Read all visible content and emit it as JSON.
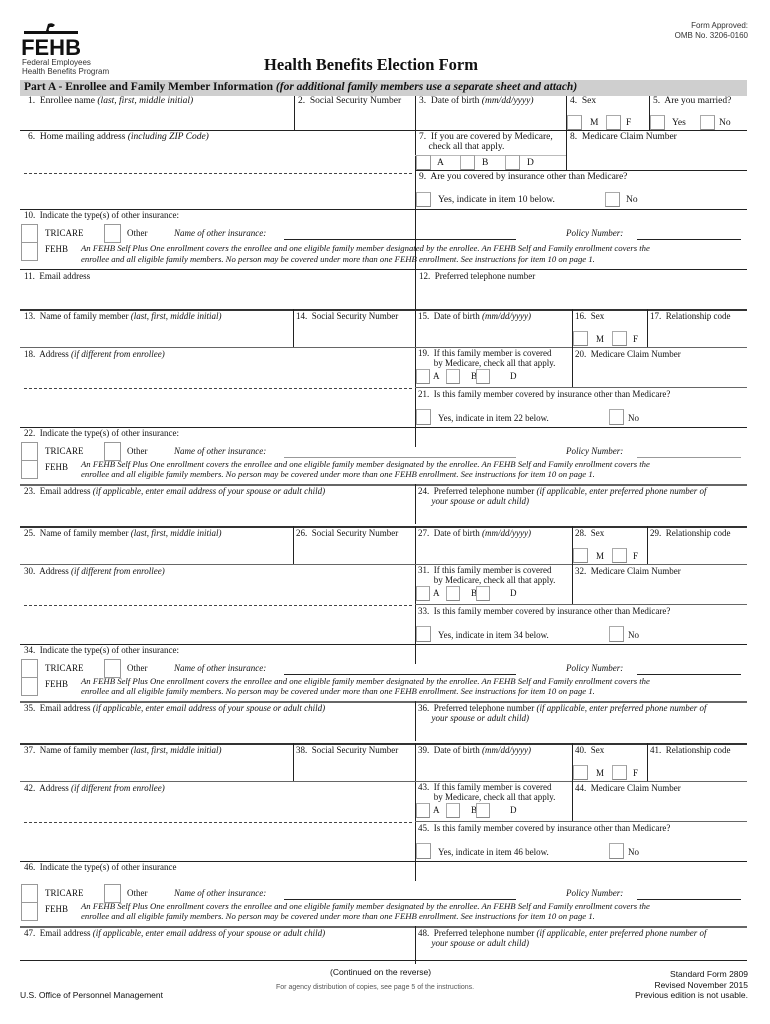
{
  "header": {
    "logo_text": "FEHB",
    "org_line1": "Federal Employees",
    "org_line2": "Health Benefits Program",
    "title": "Health Benefits Election Form",
    "approval_line1": "Form Approved:",
    "approval_line2": "OMB No. 3206-0160",
    "icon": "eagle-icon"
  },
  "part_a": {
    "title": "Part A - Enrollee and Family Member Information",
    "subtitle": "(for additional family members use a separate sheet and attach)"
  },
  "enrollee": {
    "f1_num": "1.",
    "f1_label": "Enrollee name",
    "f1_hint": "(last, first, middle initial)",
    "f2_num": "2.",
    "f2_label": "Social Security Number",
    "f3_num": "3.",
    "f3_label": "Date of birth",
    "f3_hint": "(mm/dd/yyyy)",
    "f4_num": "4.",
    "f4_label": "Sex",
    "sex_m": "M",
    "sex_f": "F",
    "f5_num": "5.",
    "f5_label": "Are you married?",
    "yes": "Yes",
    "no": "No",
    "f6_num": "6.",
    "f6_label": "Home mailing address",
    "f6_hint": "(including ZIP Code)",
    "f7_num": "7.",
    "f7_label_l1": "If you are covered by Medicare,",
    "f7_label_l2": "check all that apply.",
    "med_a": "A",
    "med_b": "B",
    "med_d": "D",
    "f8_num": "8.",
    "f8_label": "Medicare Claim Number",
    "f9_num": "9.",
    "f9_label": "Are you covered by insurance other than Medicare?",
    "f9_yes": "Yes, indicate in item 10 below.",
    "f9_no": "No",
    "f10_num": "10.",
    "f10_label": "Indicate the type(s) of other insurance:",
    "f11_num": "11.",
    "f11_label": "Email address",
    "f12_num": "12.",
    "f12_label": "Preferred telephone number"
  },
  "insurance_block": {
    "tricare": "TRICARE",
    "other": "Other",
    "name_label": "Name of other insurance:",
    "policy_label": "Policy Number:",
    "fehb": "FEHB",
    "fehb_note_l1": "An FEHB Self Plus One enrollment covers the enrollee and one eligible family member designated by the enrollee. An FEHB Self and Family enrollment covers the",
    "fehb_note_l2": "enrollee and  all eligible family members. No person may be covered under more than one FEHB enrollment. See instructions for item 10 on page 1."
  },
  "members": [
    {
      "name_num": "13.",
      "ssn_num": "14.",
      "dob_num": "15.",
      "sex_num": "16.",
      "rel_num": "17.",
      "addr_num": "18.",
      "med_num": "19.",
      "claim_num": "20.",
      "other_num": "21.",
      "other_yes": "Yes, indicate in item 22 below.",
      "type_num": "22.",
      "type_label": "Indicate the type(s) of other insurance:",
      "email_num": "23.",
      "phone_num": "24."
    },
    {
      "name_num": "25.",
      "ssn_num": "26.",
      "dob_num": "27.",
      "sex_num": "28.",
      "rel_num": "29.",
      "addr_num": "30.",
      "med_num": "31.",
      "claim_num": "32.",
      "other_num": "33.",
      "other_yes": "Yes, indicate in item 34 below.",
      "type_num": "34.",
      "type_label": "Indicate the type(s) of other insurance:",
      "email_num": "35.",
      "phone_num": "36."
    },
    {
      "name_num": "37.",
      "ssn_num": "38.",
      "dob_num": "39.",
      "sex_num": "40.",
      "rel_num": "41.",
      "addr_num": "42.",
      "med_num": "43.",
      "claim_num": "44.",
      "other_num": "45.",
      "other_yes": "Yes, indicate in item 46 below.",
      "type_num": "46.",
      "type_label": "Indicate the type(s) of other insurance",
      "email_num": "47.",
      "phone_num": "48."
    }
  ],
  "member_labels": {
    "name": "Name of family member",
    "name_hint": "(last, first, middle initial)",
    "ssn": "Social Security Number",
    "dob": "Date of birth",
    "dob_hint": "(mm/dd/yyyy)",
    "sex": "Sex",
    "m": "M",
    "f": "F",
    "rel": "Relationship code",
    "addr": "Address",
    "addr_hint": "(if different from enrollee)",
    "med_l1": "If this family member is covered",
    "med_l2": "by Medicare, check all that apply.",
    "a": "A",
    "b": "B",
    "d": "D",
    "claim": "Medicare Claim Number",
    "other_q": "Is this family member covered by insurance other than Medicare?",
    "no": "No",
    "email": "Email address",
    "email_hint": "(if applicable, enter email address of your spouse or adult child)",
    "phone": "Preferred telephone number",
    "phone_hint_l1": "(if applicable, enter preferred phone number of",
    "phone_hint_l2": "your spouse or adult child)"
  },
  "footer": {
    "continued": "(Continued on the reverse)",
    "distribution": "For agency distribution of copies, see page 5 of the instructions.",
    "agency": "U.S. Office of Personnel Management",
    "form_name": "Standard Form 2809",
    "revised": "Revised November 2015",
    "previous": "Previous edition is not usable."
  }
}
